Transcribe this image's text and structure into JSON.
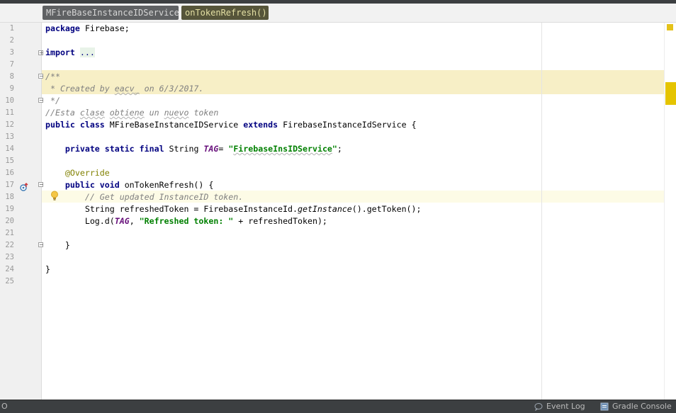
{
  "breadcrumb": {
    "items": [
      {
        "label": "MFireBaseInstanceIDService"
      },
      {
        "label": "onTokenRefresh()"
      }
    ]
  },
  "editor": {
    "line_numbers": [
      "1",
      "2",
      "3",
      "7",
      "8",
      "9",
      "10",
      "11",
      "12",
      "13",
      "14",
      "15",
      "16",
      "17",
      "18",
      "19",
      "20",
      "21",
      "22",
      "23",
      "24",
      "25"
    ],
    "code": {
      "l1": [
        "package",
        " Firebase;"
      ],
      "l3": [
        "import",
        " ",
        "..."
      ],
      "l8": [
        "/**"
      ],
      "l9": [
        " * Created by ",
        "eacv_",
        " on 6/3/2017."
      ],
      "l10": [
        " */"
      ],
      "l11": [
        "//Esta ",
        "clase",
        " ",
        "obtiene",
        " un ",
        "nuevo",
        " token"
      ],
      "l12": [
        "public",
        " ",
        "class",
        " MFireBaseInstanceIDService ",
        "extends",
        " FirebaseInstanceIdService {"
      ],
      "l14": [
        "    ",
        "private",
        " ",
        "static",
        " ",
        "final",
        " String ",
        "TAG",
        "= ",
        "\"",
        "FirebaseInsIDService",
        "\"",
        ";"
      ],
      "l16": [
        "    ",
        "@Override"
      ],
      "l17": [
        "    ",
        "public",
        " ",
        "void",
        " onTokenRefresh() {"
      ],
      "l18": [
        "        // Get updated InstanceID token."
      ],
      "l19": [
        "        String refreshedToken = FirebaseInstanceId.",
        "getInstance",
        "().getToken();"
      ],
      "l20": [
        "        Log.d(",
        "TAG",
        ", ",
        "\"Refreshed token: \"",
        " + refreshedToken);"
      ],
      "l22": [
        "    }"
      ],
      "l24": [
        "}"
      ]
    }
  },
  "icons": {
    "override_marker": "override-method-icon",
    "intention": "lightbulb-icon",
    "fold": "fold-toggle-icon"
  },
  "status_bar": {
    "left_text": "O",
    "event_log": "Event Log",
    "gradle_console": "Gradle Console"
  },
  "colors": {
    "keyword": "#000080",
    "string": "#008000",
    "comment": "#808080",
    "annotation": "#808000",
    "static_field": "#660e7a",
    "comment_highlight": "#f7efc6",
    "warning_stripe": "#e5c400"
  }
}
